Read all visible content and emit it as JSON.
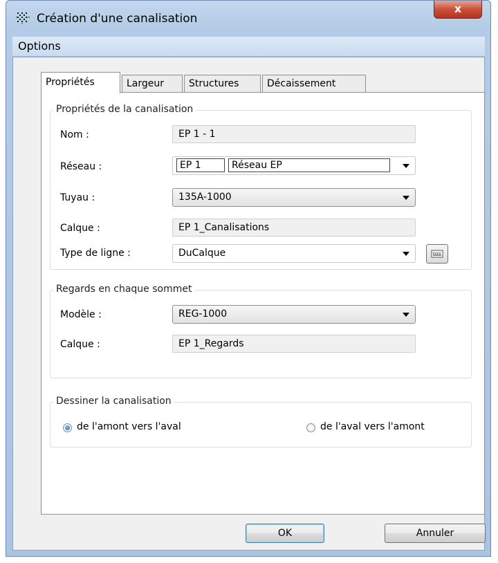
{
  "window": {
    "title": "Création d'une canalisation",
    "close_label": "x"
  },
  "menu": {
    "options": "Options"
  },
  "tabs": [
    {
      "label": "Propriétés",
      "active": true
    },
    {
      "label": "Largeur",
      "active": false
    },
    {
      "label": "Structures",
      "active": false
    },
    {
      "label": "Décaissement",
      "active": false
    }
  ],
  "canalisation": {
    "legend": "Propriétés de la canalisation",
    "nom_label": "Nom :",
    "nom_value": "EP 1 - 1",
    "reseau_label": "Réseau :",
    "reseau_code": "EP 1",
    "reseau_name": "Réseau EP",
    "tuyau_label": "Tuyau :",
    "tuyau_value": "135A-1000",
    "calque_label": "Calque :",
    "calque_value": "EP 1_Canalisations",
    "type_ligne_label": "Type de ligne  :",
    "type_ligne_value": "DuCalque"
  },
  "regards": {
    "legend": "Regards en chaque sommet",
    "modele_label": "Modèle :",
    "modele_value": "REG-1000",
    "calque_label": "Calque :",
    "calque_value": "EP 1_Regards"
  },
  "dessiner": {
    "legend": "Dessiner la canalisation",
    "option_amont": "de l'amont vers l'aval",
    "option_aval": "de l'aval vers l'amont",
    "selected": "amont"
  },
  "buttons": {
    "ok": "OK",
    "cancel": "Annuler"
  },
  "colors": {
    "title_bar": "#b3cbe6",
    "close_button": "#c9513b",
    "radio_selected": "#1f63ad"
  }
}
